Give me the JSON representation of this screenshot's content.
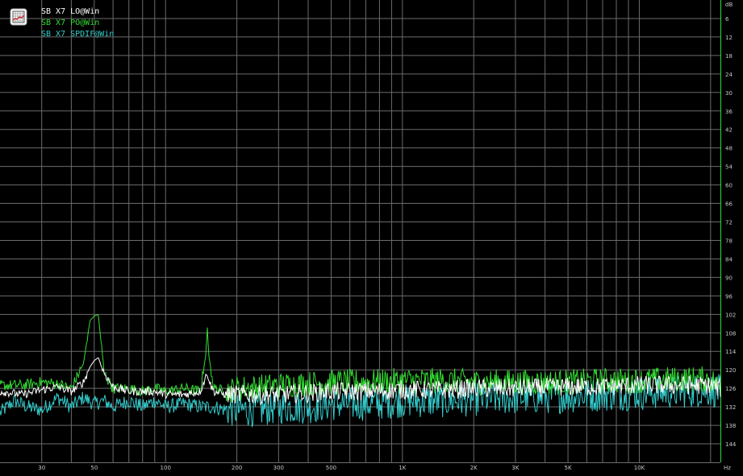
{
  "chart_data": {
    "type": "line",
    "xscale": "log",
    "xlim": [
      20,
      22000
    ],
    "ylim": [
      0,
      -150
    ],
    "y_unit": "dB",
    "x_unit": "Hz",
    "x_ticks": [
      {
        "value": 30,
        "label": "30"
      },
      {
        "value": 50,
        "label": "50"
      },
      {
        "value": 100,
        "label": "100"
      },
      {
        "value": 200,
        "label": "200"
      },
      {
        "value": 300,
        "label": "300"
      },
      {
        "value": 500,
        "label": "500"
      },
      {
        "value": 1000,
        "label": "1K"
      },
      {
        "value": 2000,
        "label": "2K"
      },
      {
        "value": 3000,
        "label": "3K"
      },
      {
        "value": 5000,
        "label": "5K"
      },
      {
        "value": 10000,
        "label": "10K"
      }
    ],
    "y_ticks": [
      -6,
      -12,
      -18,
      -24,
      -30,
      -36,
      -42,
      -48,
      -54,
      -60,
      -66,
      -72,
      -78,
      -84,
      -90,
      -96,
      -102,
      -108,
      -114,
      -120,
      -126,
      -132,
      -138,
      -144
    ],
    "y_tick_labels": [
      "6",
      "12",
      "18",
      "24",
      "30",
      "36",
      "42",
      "48",
      "54",
      "60",
      "66",
      "72",
      "78",
      "84",
      "90",
      "96",
      "102",
      "108",
      "114",
      "120",
      "126",
      "132",
      "138",
      "144"
    ],
    "grid": true,
    "legend_position": "top-left",
    "series": [
      {
        "name": "SB X7 LO@Win",
        "color": "#ffffff",
        "x": [
          20,
          25,
          30,
          35,
          40,
          45,
          48,
          50,
          52,
          55,
          60,
          70,
          80,
          90,
          100,
          120,
          140,
          150,
          155,
          160,
          180,
          200,
          250,
          300,
          400,
          500,
          700,
          1000,
          1500,
          2000,
          3000,
          5000,
          7000,
          10000,
          15000,
          20000,
          22000
        ],
        "y": [
          -127,
          -128,
          -126.5,
          -125.5,
          -127,
          -124,
          -119,
          -117,
          -116,
          -121,
          -125.5,
          -127,
          -127,
          -127,
          -128,
          -128,
          -127,
          -121,
          -125,
          -127,
          -128,
          -128,
          -128,
          -128,
          -127.5,
          -127,
          -127,
          -126.5,
          -126.5,
          -126,
          -126,
          -125.5,
          -125.5,
          -125,
          -125,
          -125,
          -126
        ]
      },
      {
        "name": "SB X7 PO@Win",
        "color": "#33dd33",
        "x": [
          20,
          25,
          30,
          35,
          40,
          45,
          48,
          50,
          52,
          55,
          60,
          70,
          80,
          90,
          100,
          120,
          140,
          148,
          150,
          152,
          160,
          180,
          200,
          250,
          300,
          400,
          500,
          700,
          1000,
          1500,
          2000,
          3000,
          5000,
          7000,
          10000,
          15000,
          20000,
          22000
        ],
        "y": [
          -125,
          -125,
          -124,
          -124.5,
          -126,
          -118,
          -104,
          -102.5,
          -102,
          -121,
          -126,
          -126,
          -127,
          -126,
          -127,
          -126,
          -127,
          -115,
          -106,
          -115,
          -126,
          -127,
          -126,
          -125.5,
          -125,
          -124.5,
          -124,
          -124,
          -123.5,
          -123.5,
          -124,
          -124,
          -124,
          -123.5,
          -123.5,
          -123,
          -123,
          -126
        ]
      },
      {
        "name": "SB X7 SPDIF@Win",
        "color": "#33cccc",
        "x": [
          20,
          23,
          26,
          30,
          35,
          40,
          45,
          50,
          55,
          60,
          70,
          80,
          90,
          100,
          120,
          140,
          160,
          180,
          200,
          250,
          300,
          400,
          500,
          700,
          1000,
          1500,
          2000,
          3000,
          5000,
          7000,
          10000,
          15000,
          20000,
          22000
        ],
        "y": [
          -134,
          -130,
          -132,
          -133,
          -129,
          -132,
          -129,
          -131,
          -130,
          -132,
          -130,
          -132,
          -130,
          -132,
          -131,
          -132,
          -132,
          -133,
          -133,
          -133,
          -132,
          -132,
          -131,
          -131,
          -130,
          -130,
          -129.5,
          -129,
          -128.5,
          -128,
          -127.5,
          -127,
          -126.5,
          -127
        ]
      }
    ]
  }
}
